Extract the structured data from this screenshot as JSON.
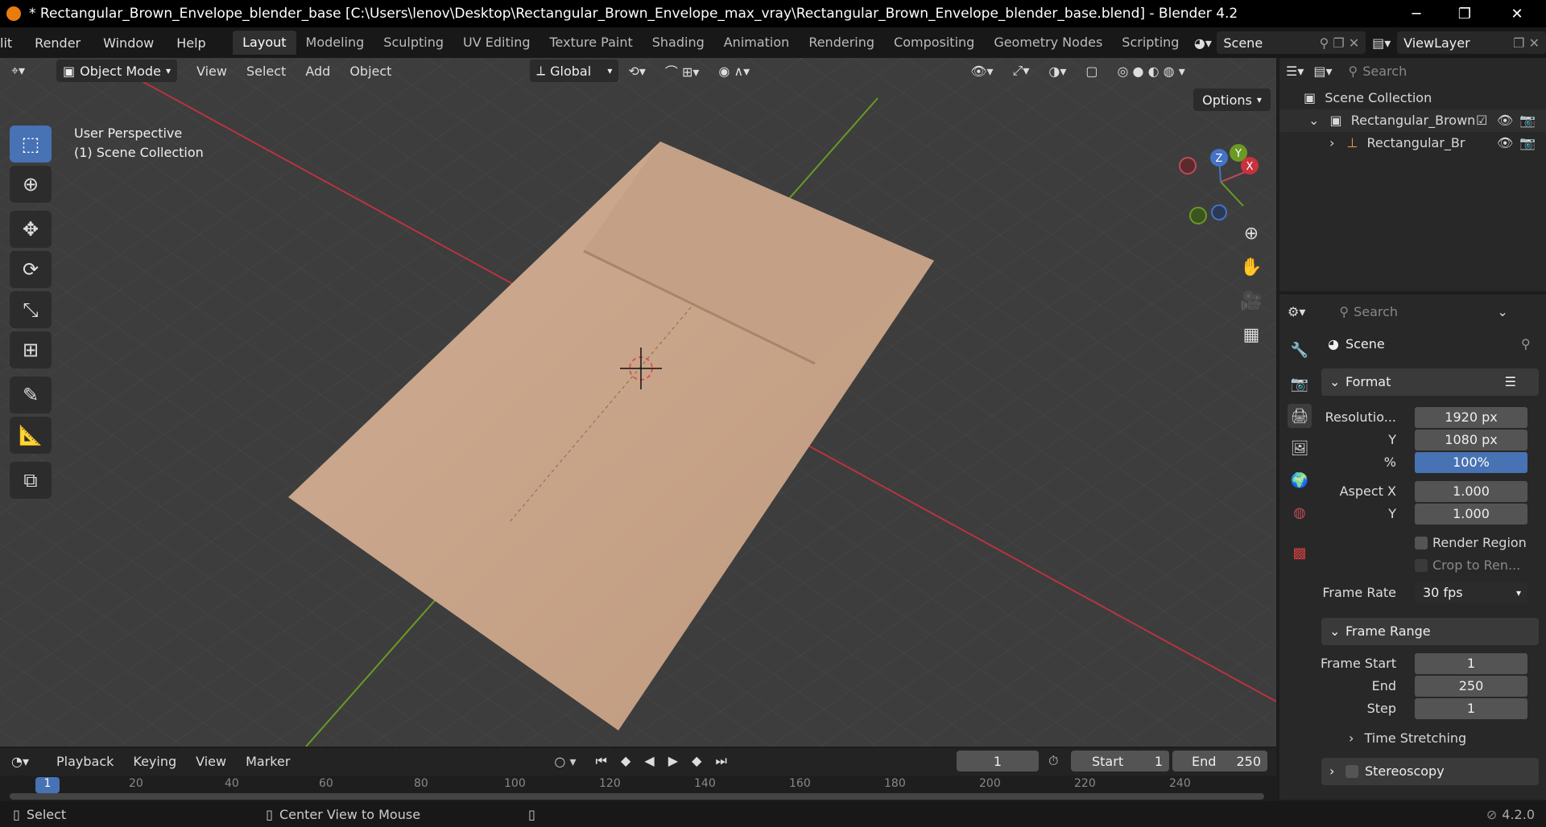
{
  "window": {
    "title": "* Rectangular_Brown_Envelope_blender_base [C:\\Users\\lenov\\Desktop\\Rectangular_Brown_Envelope_max_vray\\Rectangular_Brown_Envelope_blender_base.blend] - Blender 4.2",
    "minimize": "─",
    "restore": "❐",
    "close": "✕"
  },
  "menu": {
    "items": [
      "lit",
      "Render",
      "Window",
      "Help"
    ],
    "workspaces": [
      "Layout",
      "Modeling",
      "Sculpting",
      "UV Editing",
      "Texture Paint",
      "Shading",
      "Animation",
      "Rendering",
      "Compositing",
      "Geometry Nodes",
      "Scripting"
    ],
    "active_workspace": "Layout",
    "scene": "Scene",
    "view_layer": "ViewLayer"
  },
  "viewport": {
    "mode": "Object Mode",
    "menus": [
      "View",
      "Select",
      "Add",
      "Object"
    ],
    "transform_orientation": "Global",
    "options_label": "Options",
    "overlay_line1": "User Perspective",
    "overlay_line2": "(1) Scene Collection",
    "gizmo": {
      "x": "X",
      "y": "Y",
      "z": "Z"
    }
  },
  "outliner": {
    "search_placeholder": "Search",
    "root": "Scene Collection",
    "collection": "Rectangular_Brown",
    "object": "Rectangular_Br"
  },
  "properties": {
    "search_placeholder": "Search",
    "context": "Scene",
    "format_panel": "Format",
    "resolution_x_label": "Resolutio...",
    "resolution_x": "1920 px",
    "resolution_y_label": "Y",
    "resolution_y": "1080 px",
    "percent_label": "%",
    "percent": "100%",
    "aspect_x_label": "Aspect X",
    "aspect_x": "1.000",
    "aspect_y_label": "Y",
    "aspect_y": "1.000",
    "render_region": "Render Region",
    "crop": "Crop to Ren...",
    "frame_rate_label": "Frame Rate",
    "frame_rate": "30 fps",
    "frame_range_panel": "Frame Range",
    "frame_start_label": "Frame Start",
    "frame_start": "1",
    "end_label": "End",
    "end": "250",
    "step_label": "Step",
    "step": "1",
    "time_stretching": "Time Stretching",
    "stereoscopy": "Stereoscopy"
  },
  "timeline": {
    "menus": [
      "Playback",
      "Keying",
      "View",
      "Marker"
    ],
    "current_frame": "1",
    "start_label": "Start",
    "start": "1",
    "end_label": "End",
    "end": "250",
    "ruler": [
      "1",
      "20",
      "40",
      "60",
      "80",
      "100",
      "120",
      "140",
      "160",
      "180",
      "200",
      "220",
      "240"
    ]
  },
  "status": {
    "select": "Select",
    "center": "Center View to Mouse",
    "version": "4.2.0"
  },
  "colors": {
    "accent": "#4772b3",
    "envelope": "#c9a68b",
    "x_axis": "#b8343f",
    "y_axis": "#6a9a23"
  }
}
